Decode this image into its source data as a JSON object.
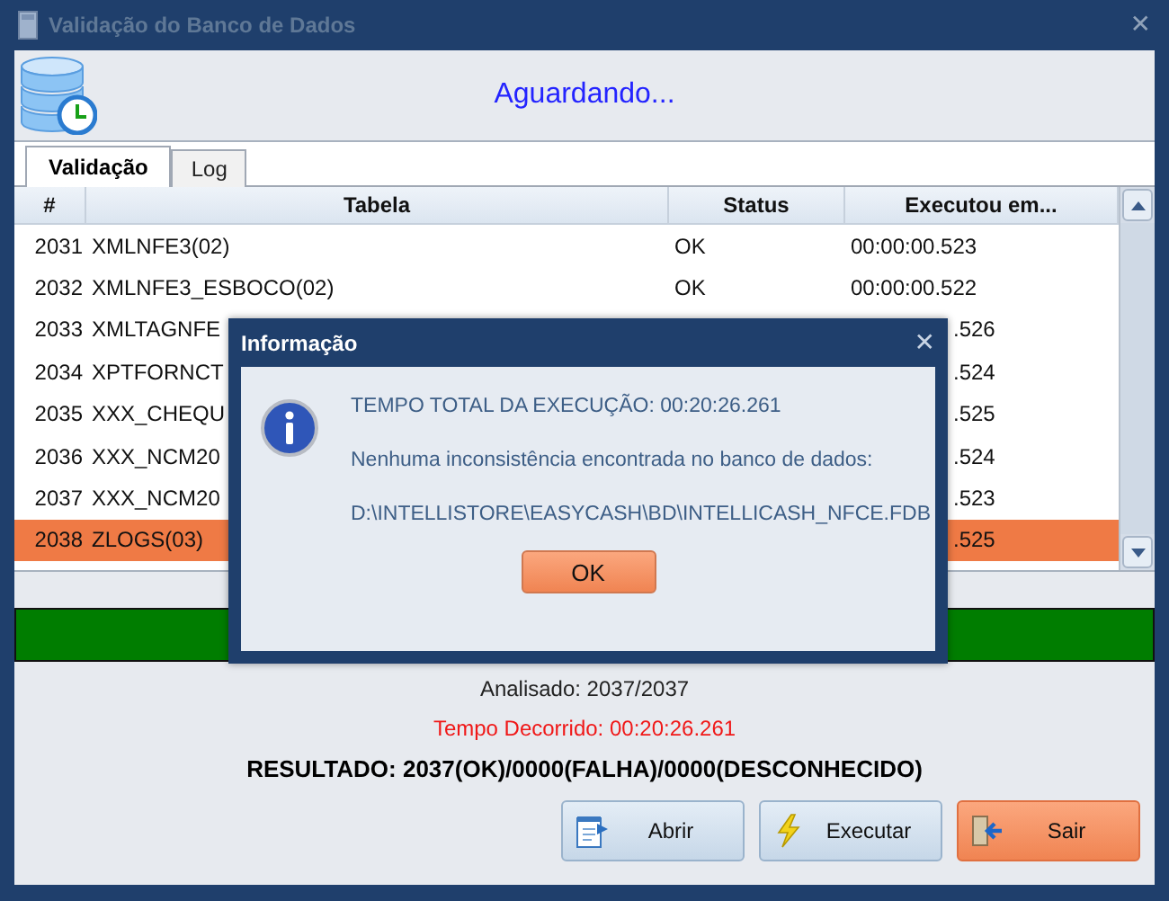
{
  "window": {
    "title": "Validação do Banco de Dados",
    "close": "✕"
  },
  "header": {
    "status": "Aguardando..."
  },
  "tabs": [
    {
      "label": "Validação",
      "selected": true
    },
    {
      "label": "Log",
      "selected": false
    }
  ],
  "table": {
    "columns": [
      "#",
      "Tabela",
      "Status",
      "Executou em..."
    ],
    "rows": [
      {
        "num": "2031",
        "table": "XMLNFE3(02)",
        "status": "OK",
        "time": "00:00:00.523",
        "selected": false
      },
      {
        "num": "2032",
        "table": "XMLNFE3_ESBOCO(02)",
        "status": "OK",
        "time": "00:00:00.522",
        "selected": false
      },
      {
        "num": "2033",
        "table": "XMLTAGNFE",
        "time": ".526",
        "selected": false
      },
      {
        "num": "2034",
        "table": "XPTFORNCT",
        "time": ".524",
        "selected": false
      },
      {
        "num": "2035",
        "table": "XXX_CHEQU",
        "time": ".525",
        "selected": false
      },
      {
        "num": "2036",
        "table": "XXX_NCM20",
        "time": ".524",
        "selected": false
      },
      {
        "num": "2037",
        "table": "XXX_NCM20",
        "time": ".523",
        "selected": false
      },
      {
        "num": "2038",
        "table": "ZLOGS(03)",
        "time": ".525",
        "selected": true
      }
    ]
  },
  "progress": {
    "level": 1
  },
  "summary": {
    "analyzed": "Analisado: 2037/2037",
    "elapsed": "Tempo Decorrido: 00:20:26.261",
    "result": "RESULTADO: 2037(OK)/0000(FALHA)/0000(DESCONHECIDO)"
  },
  "buttons": [
    {
      "label": "Abrir",
      "kind": "open"
    },
    {
      "label": "Executar",
      "kind": "run"
    },
    {
      "label": "Sair",
      "kind": "exit"
    }
  ],
  "dialog": {
    "title": "Informação",
    "close": "✕",
    "lines": [
      "TEMPO TOTAL DA EXECUÇÃO: 00:20:26.261",
      "Nenhuma inconsistência encontrada no banco de dados:",
      "D:\\INTELLISTORE\\EASYCASH\\BD\\INTELLICASH_NFCE.FDB"
    ],
    "button": "OK"
  }
}
